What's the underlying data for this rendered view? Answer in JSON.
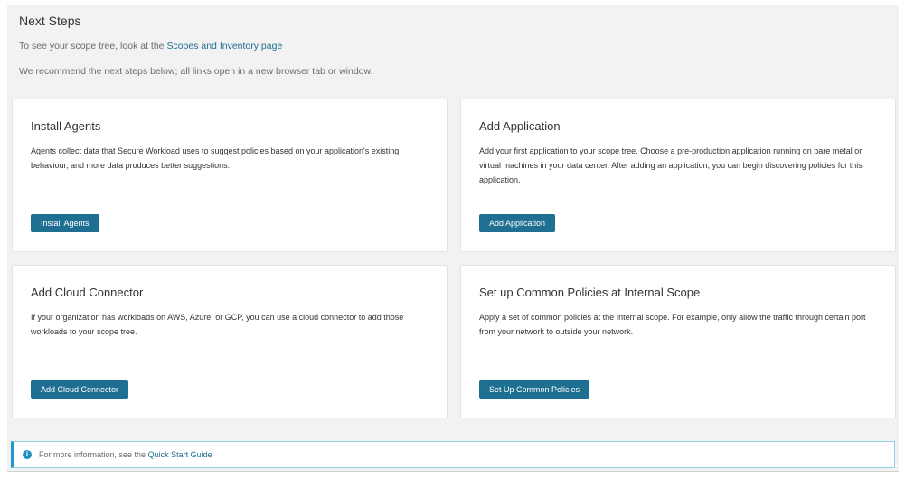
{
  "title": "Next Steps",
  "scope_line": {
    "prefix": "To see your scope tree, look at the ",
    "link": "Scopes and Inventory page"
  },
  "recommend": "We recommend the next steps below; all links open in a new browser tab or window.",
  "cards": [
    {
      "title": "Install Agents",
      "text": "Agents collect data that Secure Workload uses to suggest policies based on your application's existing behaviour, and more data produces better suggestions.",
      "button": "Install Agents"
    },
    {
      "title": "Add Application",
      "text": "Add your first application to your scope tree. Choose a pre-production application running on bare metal or virtual machines in your data center. After adding an application, you can begin discovering policies for this application.",
      "button": "Add Application"
    },
    {
      "title": "Add Cloud Connector",
      "text": "If your organization has workloads on AWS, Azure, or GCP, you can use a cloud connector to add those workloads to your scope tree.",
      "button": "Add Cloud Connector"
    },
    {
      "title": "Set up Common Policies at Internal Scope",
      "text": "Apply a set of common policies at the Internal scope. For example, only allow the traffic through certain port from your network to outside your network.",
      "button": "Set Up Common Policies"
    }
  ],
  "info": {
    "icon": "info-icon",
    "glyph": "i",
    "prefix": "For more information, see the ",
    "link": "Quick Start Guide"
  }
}
